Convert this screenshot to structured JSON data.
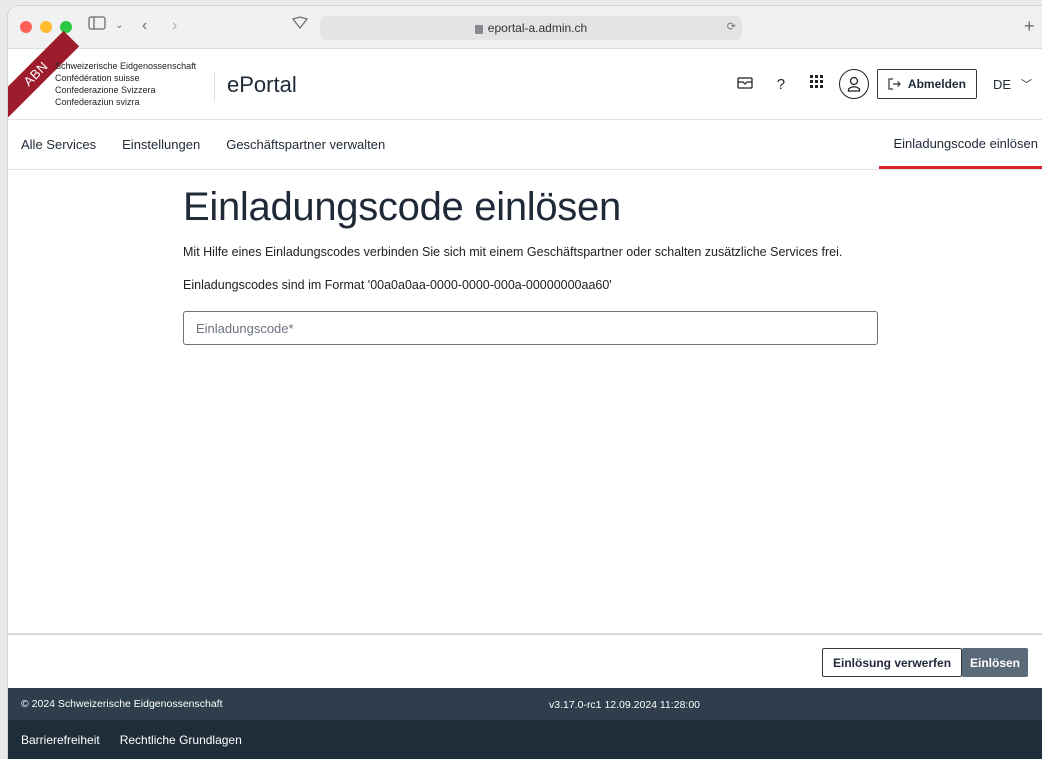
{
  "browser": {
    "url": "eportal-a.admin.ch",
    "traffic_lights": [
      "#fe5f57",
      "#febc2e",
      "#28c840"
    ]
  },
  "header": {
    "ribbon_text": "ABN",
    "federation_lines": [
      "Schweizerische Eidgenossenschaft",
      "Confédération suisse",
      "Confederazione Svizzera",
      "Confederaziun svizra"
    ],
    "portal_title": "ePortal",
    "logout_label": "Abmelden",
    "language": "DE"
  },
  "nav": {
    "items": [
      "Alle Services",
      "Einstellungen",
      "Geschäftspartner verwalten"
    ],
    "active_item": "Einladungscode einlösen"
  },
  "main": {
    "title": "Einladungscode einlösen",
    "description": "Mit Hilfe eines Einladungscodes verbinden Sie sich mit einem Geschäftspartner oder schalten zusätzliche Services frei.",
    "format_hint": "Einladungscodes sind im Format '00a0a0aa-0000-0000-000a-00000000aa60'",
    "input_placeholder": "Einladungscode*",
    "input_value": ""
  },
  "actions": {
    "discard_label": "Einlösung verwerfen",
    "redeem_label": "Einlösen"
  },
  "footer": {
    "copyright": "© 2024 Schweizerische Eidgenossenschaft",
    "version": "v3.17.0-rc1 12.09.2024 11:28:00",
    "links": [
      "Barrierefreiheit",
      "Rechtliche Grundlagen"
    ]
  },
  "colors": {
    "accent_red": "#d8232a",
    "ribbon": "#9c1c2c",
    "primary_button": "#5b6a78",
    "footer_top": "#2f3d4c",
    "footer_bottom": "#1f2c3a"
  }
}
